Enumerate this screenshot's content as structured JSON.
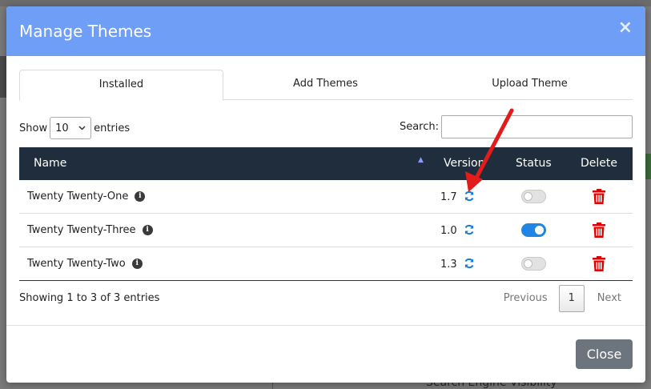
{
  "modal": {
    "title": "Manage Themes",
    "close_icon": "×",
    "tabs": [
      {
        "label": "Installed",
        "active": true
      },
      {
        "label": "Add Themes",
        "active": false
      },
      {
        "label": "Upload Theme",
        "active": false
      }
    ],
    "length": {
      "prefix": "Show",
      "value": "10",
      "suffix": "entries"
    },
    "search": {
      "label": "Search:",
      "value": ""
    },
    "table": {
      "columns": [
        "Name",
        "Version",
        "Status",
        "Delete"
      ],
      "rows": [
        {
          "name": "Twenty Twenty-One",
          "version": "1.7",
          "status_on": false
        },
        {
          "name": "Twenty Twenty-Three",
          "version": "1.0",
          "status_on": true
        },
        {
          "name": "Twenty Twenty-Two",
          "version": "1.3",
          "status_on": false
        }
      ]
    },
    "info": "Showing 1 to 3 of 3 entries",
    "pagination": {
      "previous": "Previous",
      "page": "1",
      "next": "Next"
    },
    "footer": {
      "close_label": "Close"
    }
  },
  "background": {
    "bottom_text": "Search Engine Visibility"
  },
  "colors": {
    "header": "#6f9ef6",
    "table_head": "#1f2d3d",
    "toggle_on": "#1f86e6",
    "trash": "#e00000",
    "refresh": "#1a7ad9",
    "annotation_arrow": "#e21b1b"
  },
  "icons": {
    "info": "info-circle-icon",
    "refresh": "refresh-icon",
    "delete": "trash-icon",
    "sort": "sort-ascending-icon",
    "chevron": "chevron-down-icon"
  }
}
